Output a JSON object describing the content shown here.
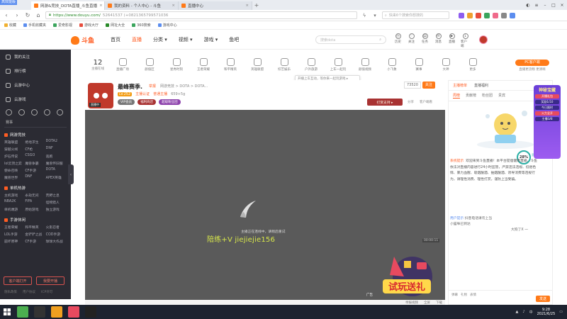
{
  "browser": {
    "corner_badge": "高效能版",
    "tabs": [
      {
        "title": "网游&竞技_DOTA直播_斗鱼直播",
        "active": true,
        "color": "#ff7a18"
      },
      {
        "title": "我的资料 - 个人中心 - 斗鱼",
        "active": false,
        "color": "#ff7a18"
      },
      {
        "title": "直播中心",
        "active": false,
        "color": "#ff7a18"
      }
    ],
    "url": "https://www.douyu.com/",
    "url_rest": "52641537 (+0821365799571036",
    "search_placeholder": "快来6个搜索你想搜的",
    "bookmarks": [
      "收藏",
      "手机收藏夹",
      "爱奇影视",
      "游戏大厅",
      "网址大全",
      "360搜索",
      "游戏中心"
    ]
  },
  "header": {
    "logo_text": "斗鱼",
    "nav": [
      {
        "label": "首页",
        "active": false
      },
      {
        "label": "直播",
        "active": true
      },
      {
        "label": "分类 ▾",
        "active": false
      },
      {
        "label": "视频 ▾",
        "active": false
      },
      {
        "label": "游戏 ▾",
        "active": false
      },
      {
        "label": "鱼吧",
        "active": false
      }
    ],
    "search_placeholder": "搜索dota",
    "icons": [
      {
        "name": "history-icon",
        "label": "历史"
      },
      {
        "name": "follow-icon",
        "label": "关注"
      },
      {
        "name": "task-icon",
        "label": "任务"
      },
      {
        "name": "message-icon",
        "label": "消息"
      },
      {
        "name": "live-icon",
        "label": "直播"
      },
      {
        "name": "download-icon",
        "label": "客户端"
      }
    ]
  },
  "sidebar": {
    "top_items": [
      "我的关注",
      "排行榜",
      "云游中心",
      "云游戏"
    ],
    "icon_row_label": "赛事",
    "sections": [
      {
        "title": "网游竞技",
        "items": [
          "英雄联盟",
          "绝地求生",
          "DOTA2",
          "穿越火线",
          "CF枪",
          "DNF",
          "炉石传说",
          "CSGO",
          "逃跑",
          "lol云顶之弈",
          "魔兽争霸",
          "魔兽怀旧服",
          "使命召唤",
          "CF手游",
          "DOTA",
          "魔兽世界",
          "DNF",
          "APEX英雄"
        ]
      },
      {
        "title": "单机热游",
        "items": [
          "主机游戏",
          "永劫无间",
          "荒野之息",
          "NBA2K",
          "FIFA",
          "怪物猎人",
          "单机端游",
          "原始游戏",
          "独立游戏"
        ]
      },
      {
        "title": "手游休闲",
        "items": [
          "王者荣耀",
          "和平精英",
          "火影忍者",
          "LOL手游",
          "金铲铲之战",
          "COD手游",
          "崩坏原神",
          "CF手游",
          "球球大作战"
        ]
      }
    ],
    "buttons": [
      "客户端打开",
      "我要开播"
    ],
    "footer": [
      "隐私政策",
      "用户协议",
      "ICP许可"
    ]
  },
  "categories": {
    "count": "12",
    "count_label": "主播在线",
    "items": [
      "直播广场",
      "颜值区",
      "星秀时刻",
      "王者荣耀",
      "和平精英",
      "英雄联盟",
      "综艺娱乐",
      "户外旅游",
      "上车一起玩",
      "颜值视频",
      "小飞象",
      "赛事",
      "大神",
      "更多"
    ],
    "pc_button": "PC客户端",
    "pc_sub": "直播更流畅 更清晰",
    "tooltip": "开播上车互动，等你来一起玩游戏 ▸"
  },
  "room": {
    "title": "最峰赛季.",
    "category": "网游竞技 > DOTA > DOTA...",
    "tag": "举报",
    "level": "LV.252",
    "sub_items": [
      "主播认证",
      "普通主播",
      "659+5g"
    ],
    "tags": [
      {
        "label": "VIP会员",
        "color": "#777"
      },
      {
        "label": "福利商店",
        "color": "#a83232"
      },
      {
        "label": "超级粉丝团",
        "color": "#8e44ad"
      }
    ],
    "follow_count": "73520",
    "follow_label": "关注",
    "gift_button": "打赏支持 ▸",
    "actions": [
      "分享",
      "客户端看"
    ],
    "avatar_badge": "直播中"
  },
  "player": {
    "message": "主播正在连线中，请稍后重试",
    "watermark": "陪练+V  jiejiejie156",
    "timer": "00:00:11",
    "ad_label": "广告",
    "ad_text": "试玩送礼",
    "bottom_controls": [
      "举报视频",
      "全屏",
      "下载"
    ]
  },
  "chat": {
    "top_tabs": [
      {
        "label": "主播榜单",
        "active": true
      },
      {
        "label": "直播福利",
        "active": false
      }
    ],
    "tabs": [
      {
        "label": "周榜",
        "active": true
      },
      {
        "label": "贡献榜",
        "active": false
      },
      {
        "label": "粉丝团",
        "active": false
      },
      {
        "label": "贵宾",
        "active": false
      }
    ],
    "percent": "28",
    "percent_side": "贡献榜\n热度",
    "system_tag": "系统提示",
    "system_message": "欢迎来到斗鱼直播！本平台提倡健康直播，斗鱼依法对直播内容进行24小时监管，严禁违法违规、低俗色情、暴力血腥、吸烟酗酒、抽烟酗酒、诱导消费等违规行为，请理性消费、理性打赏，谨防上当受骗。",
    "lines": [
      {
        "name": "用户提示",
        "text": "抖音电话请勿上当"
      },
      {
        "name": "",
        "text": "小猫咪已到达"
      },
      {
        "name": "",
        "text": "大狗了X 一"
      }
    ],
    "input_buttons": [
      "弹幕",
      "礼物",
      "表情"
    ],
    "send": "发送"
  },
  "float_promo": {
    "title": "神秘宝藏",
    "rows": [
      "开播礼包",
      "奖励1/10",
      "今日限时",
      "火力全开",
      "主播LV8"
    ]
  },
  "taskbar": {
    "time": "9:28",
    "date": "2021/6/25"
  }
}
